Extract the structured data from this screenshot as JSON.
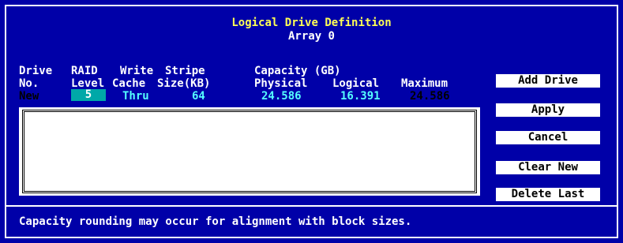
{
  "dialog": {
    "title": "Logical Drive Definition",
    "subtitle": "Array 0"
  },
  "headers": {
    "drive_line1": "Drive",
    "drive_line2": "No.",
    "raid_line1": "RAID",
    "raid_line2": "Level",
    "write_line1": "Write",
    "write_line2": "Cache",
    "stripe_line1": "Stripe",
    "stripe_line2": "Size(KB)",
    "capacity_line1": "Capacity (GB)",
    "physical": "Physical",
    "logical": "Logical",
    "maximum": "Maximum"
  },
  "new_drive": {
    "drive_no": "New",
    "raid_level": "5",
    "write_cache": "Thru",
    "stripe_size": "64",
    "physical": "24.586",
    "logical": "16.391",
    "maximum": "24.586"
  },
  "buttons": {
    "add_drive": "Add Drive",
    "apply": "Apply",
    "cancel": "Cancel",
    "clear_new": "Clear New",
    "delete_last": "Delete Last"
  },
  "status": "Capacity rounding may occur for alignment with block sizes.",
  "colors": {
    "background": "#0000a8",
    "title": "#ffff55",
    "value": "#55ffff",
    "raid_box": "#00a8a8"
  }
}
